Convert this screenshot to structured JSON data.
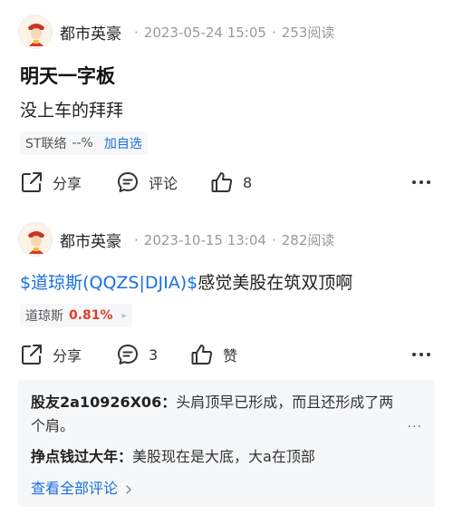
{
  "posts": [
    {
      "author": "都市英豪",
      "date": "2023-05-24 15:05",
      "reads": "253阅读",
      "title": "明天一字板",
      "body": "没上车的拜拜",
      "stock": {
        "name": "ST联络",
        "change": "--%",
        "add_label": "加自选"
      },
      "actions": {
        "share": "分享",
        "comment": "评论",
        "like": "8"
      }
    },
    {
      "author": "都市英豪",
      "date": "2023-10-15 13:04",
      "reads": "282阅读",
      "tag": "$道琼斯(QQZS|DJIA)$",
      "body": "感觉美股在筑双顶啊",
      "stock": {
        "name": "道琼斯",
        "change": "0.81%"
      },
      "actions": {
        "share": "分享",
        "comment": "3",
        "like": "赞"
      },
      "comments": [
        {
          "user": "股友2a10926X06：",
          "text": "头肩顶早已形成，而且还形成了两个肩。"
        },
        {
          "user": "挣点钱过大年：",
          "text": "美股现在是大底，大a在顶部"
        }
      ],
      "view_all": "查看全部评论",
      "comment_more": "..."
    }
  ],
  "colors": {
    "link": "#1a6fe0",
    "up": "#e23d2a",
    "muted": "#999999"
  },
  "icons": [
    "avatar-icon",
    "share-icon",
    "comment-icon",
    "like-icon",
    "more-icon",
    "chevron-right-icon"
  ]
}
